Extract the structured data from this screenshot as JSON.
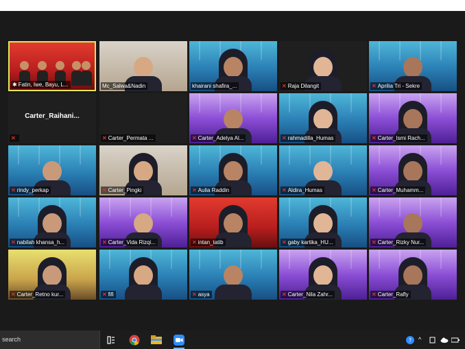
{
  "participants": [
    {
      "name": "Fatin, Iwe, Bayu, L...",
      "bg": "red",
      "muted": false,
      "pinned": true,
      "speaking": true,
      "group": true
    },
    {
      "name": "Mc_Salwa&Nadin",
      "bg": "room",
      "muted": false
    },
    {
      "name": "khairani shafira_...",
      "bg": "blue",
      "muted": false
    },
    {
      "name": "Raja Dilangit",
      "bg": "black",
      "muted": true
    },
    {
      "name": "Aprilia Tri - Sekre",
      "bg": "blue",
      "muted": true
    },
    {
      "name": "",
      "bg": "black",
      "muted": true,
      "video_off": true,
      "display": "Carter_Raihani..."
    },
    {
      "name": "Carter_Permata ...",
      "bg": "black",
      "muted": true,
      "video_off": true
    },
    {
      "name": "Carter_Adelya Al...",
      "bg": "purple",
      "muted": true
    },
    {
      "name": "rahmadilla_Humas",
      "bg": "blue",
      "muted": true
    },
    {
      "name": "Carter_Ismi Rach...",
      "bg": "purple",
      "muted": true
    },
    {
      "name": "rindy_perkap",
      "bg": "blue",
      "muted": true
    },
    {
      "name": "Carter_Pingki",
      "bg": "room",
      "muted": true
    },
    {
      "name": "Aulia Raddin",
      "bg": "blue",
      "muted": true
    },
    {
      "name": "Aldira_Humas",
      "bg": "blue",
      "muted": true
    },
    {
      "name": "Carter_Muhamm...",
      "bg": "purple",
      "muted": true
    },
    {
      "name": "nabilah khansa_h...",
      "bg": "blue",
      "muted": true
    },
    {
      "name": "Carter_Vida Rizqi...",
      "bg": "purple",
      "muted": true
    },
    {
      "name": "intan_tatib",
      "bg": "red",
      "muted": true
    },
    {
      "name": "gaby kartika_HU...",
      "bg": "blue",
      "muted": true
    },
    {
      "name": "Carter_Rizky Nur...",
      "bg": "purple",
      "muted": true
    },
    {
      "name": "Carter_Retno kur...",
      "bg": "yellow",
      "muted": true
    },
    {
      "name": "fifi",
      "bg": "blue",
      "muted": true
    },
    {
      "name": "asya",
      "bg": "blue",
      "muted": true
    },
    {
      "name": "Carter_Nila Zahr...",
      "bg": "purple",
      "muted": true
    },
    {
      "name": "Carter_Rafly",
      "bg": "purple",
      "muted": true
    }
  ],
  "taskbar": {
    "search_label": "search",
    "apps": [
      "task-view-icon",
      "chrome-icon",
      "file-explorer-icon",
      "zoom-icon"
    ],
    "active_app": "zoom-icon"
  },
  "colors": {
    "speaking_border": "#e6e65a",
    "muted_mic": "#e03030",
    "taskbar": "#1c1c1c"
  }
}
